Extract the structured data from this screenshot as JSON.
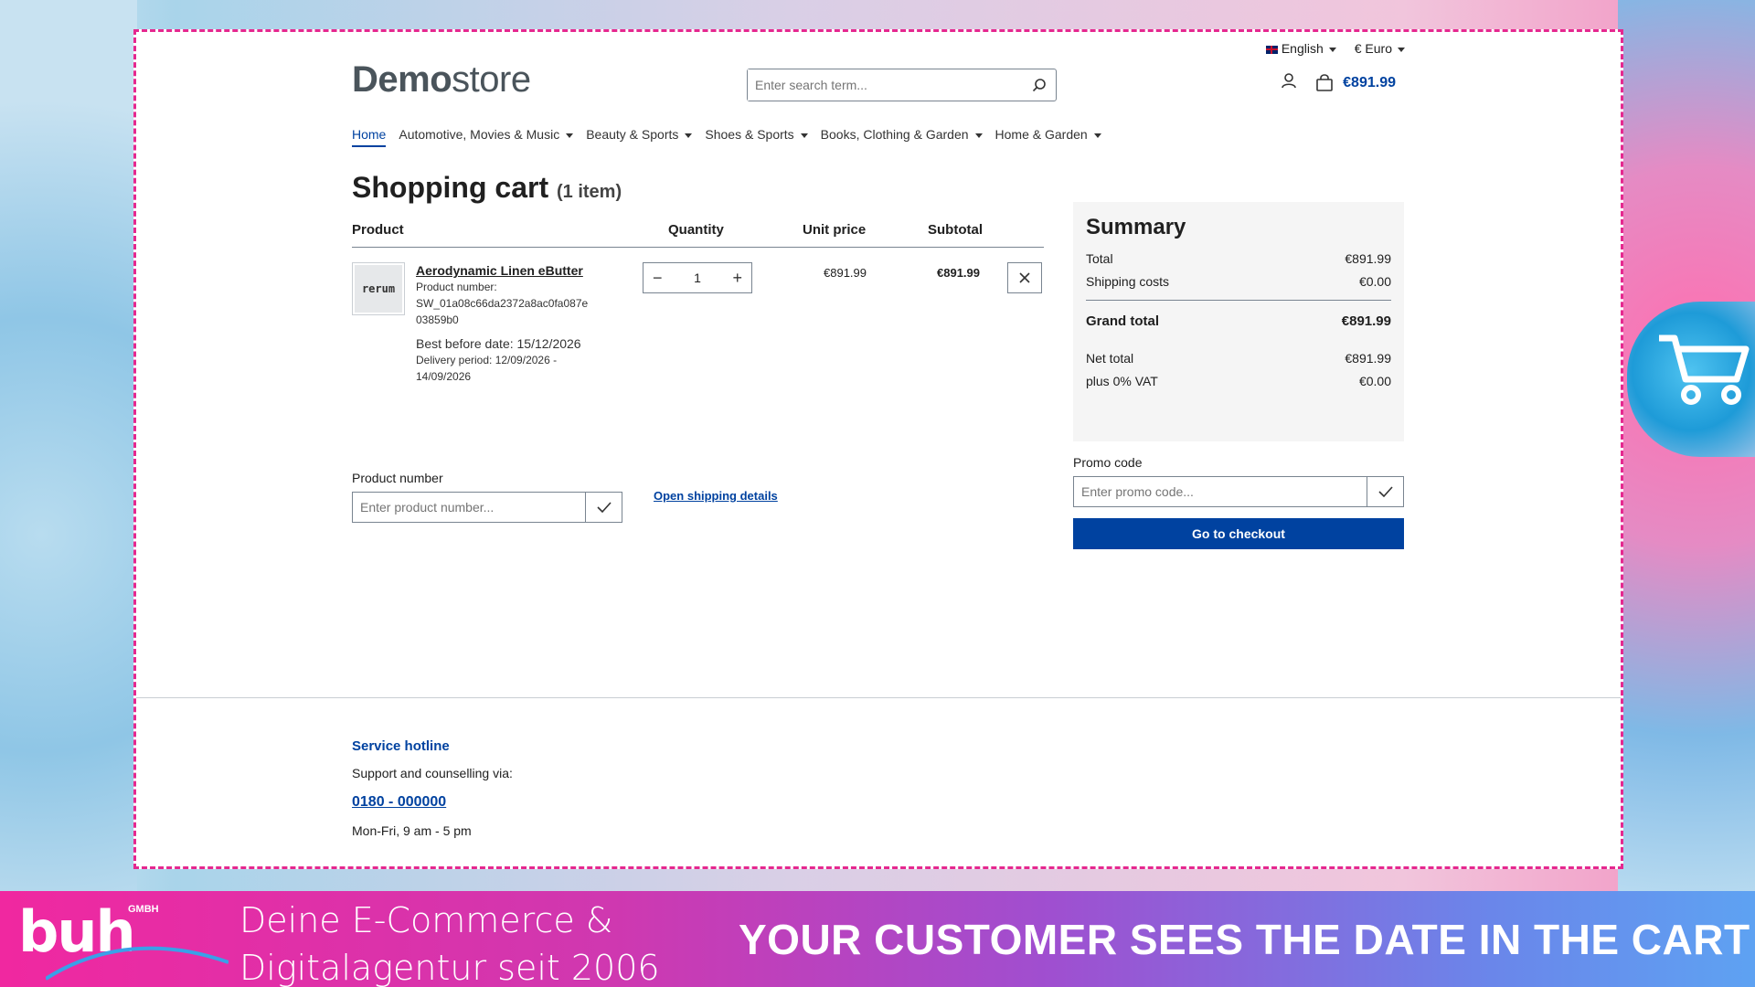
{
  "header": {
    "language": "English",
    "currency": "€ Euro",
    "logo_bold": "Demo",
    "logo_light": "store",
    "search_placeholder": "Enter search term...",
    "cart_total": "€891.99"
  },
  "nav": {
    "items": [
      {
        "label": "Home"
      },
      {
        "label": "Automotive, Movies & Music"
      },
      {
        "label": "Beauty & Sports"
      },
      {
        "label": "Shoes & Sports"
      },
      {
        "label": "Books, Clothing & Garden"
      },
      {
        "label": "Home & Garden"
      }
    ]
  },
  "cart": {
    "title": "Shopping cart",
    "count": "(1 item)",
    "columns": {
      "product": "Product",
      "quantity": "Quantity",
      "unit_price": "Unit price",
      "subtotal": "Subtotal"
    },
    "item": {
      "thumb_text": "rerum",
      "name": "Aerodynamic Linen eButter",
      "number_label": "Product number:",
      "number_line1": "SW_01a08c66da2372a8ac0fa087e",
      "number_line2": "03859b0",
      "best_before": "Best before date: 15/12/2026",
      "delivery_line1": "Delivery period: 12/09/2026 -",
      "delivery_line2": "14/09/2026",
      "quantity": "1",
      "unit_price": "€891.99",
      "subtotal": "€891.99"
    },
    "product_number_label": "Product number",
    "product_number_placeholder": "Enter product number...",
    "shipping_link": "Open shipping details"
  },
  "summary": {
    "title": "Summary",
    "total_label": "Total",
    "total_value": "€891.99",
    "shipping_label": "Shipping costs",
    "shipping_value": "€0.00",
    "grand_label": "Grand total",
    "grand_value": "€891.99",
    "net_label": "Net total",
    "net_value": "€891.99",
    "vat_label": "plus 0% VAT",
    "vat_value": "€0.00",
    "promo_label": "Promo code",
    "promo_placeholder": "Enter promo code...",
    "checkout": "Go to checkout"
  },
  "footer": {
    "title": "Service hotline",
    "text": "Support and counselling via:",
    "phone": "0180 - 000000",
    "hours": "Mon-Fri, 9 am - 5 pm"
  },
  "banner": {
    "logo": "buh",
    "logo_suffix": "GMBH",
    "tagline_line1": "Deine E-Commerce &",
    "tagline_line2": "Digitalagentur seit 2006",
    "headline": "YOUR CUSTOMER SEES THE DATE IN THE CART"
  },
  "colors": {
    "accent": "#0042a0",
    "frame": "#e5288f"
  }
}
